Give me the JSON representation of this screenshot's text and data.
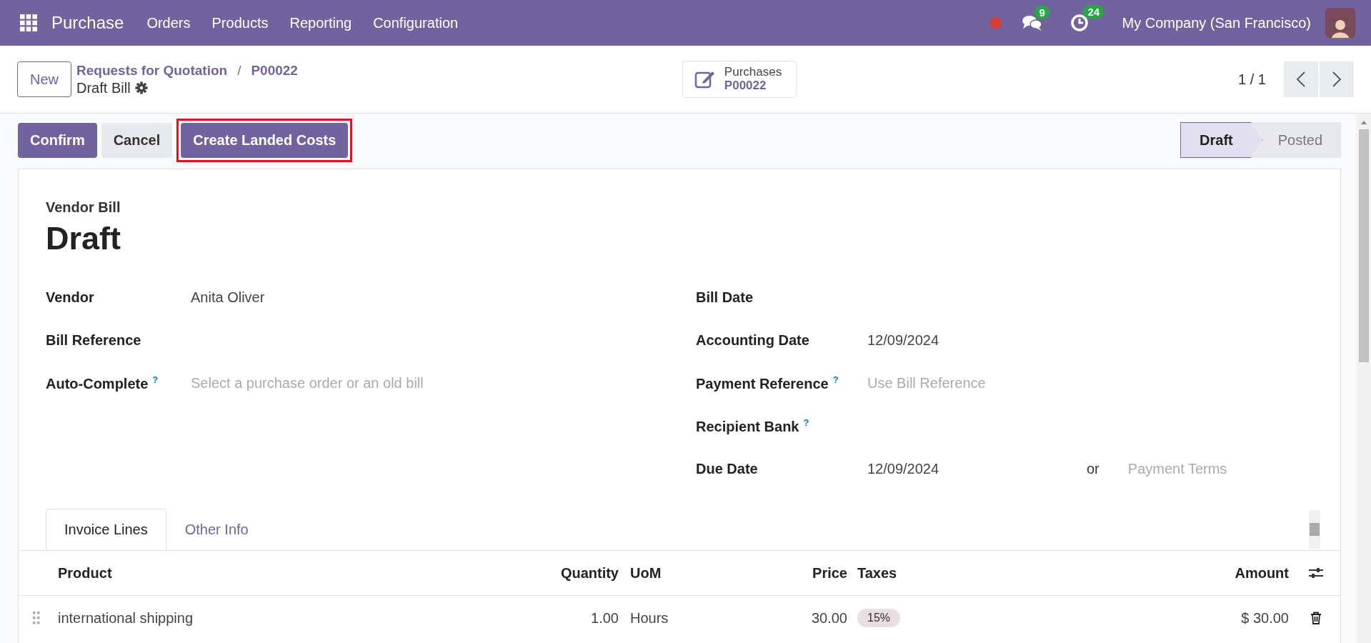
{
  "navbar": {
    "app_name": "Purchase",
    "menu": [
      "Orders",
      "Products",
      "Reporting",
      "Configuration"
    ],
    "status_dot": {
      "color": "#d23f3a"
    },
    "messages": {
      "count": "9"
    },
    "activities": {
      "count": "24"
    },
    "company": "My Company (San Francisco)"
  },
  "control_panel": {
    "new_button": "New",
    "breadcrumbs": [
      "Requests for Quotation",
      "P00022"
    ],
    "breadcrumb_separator": "/",
    "title": "Draft Bill",
    "smart_button": {
      "label": "Purchases",
      "value": "P00022"
    },
    "pager": "1 / 1"
  },
  "actions": [
    {
      "label": "Confirm",
      "kind": "primary",
      "highlighted": false
    },
    {
      "label": "Cancel",
      "kind": "secondary",
      "highlighted": false
    },
    {
      "label": "Create Landed Costs",
      "kind": "primary",
      "highlighted": true
    }
  ],
  "statusbar": [
    {
      "label": "Draft",
      "selected": true
    },
    {
      "label": "Posted",
      "selected": false
    }
  ],
  "form": {
    "subtitle": "Vendor Bill",
    "title": "Draft",
    "left_fields": [
      {
        "label": "Vendor",
        "value": "Anita Oliver"
      },
      {
        "label": "Bill Reference"
      },
      {
        "label": "Auto-Complete",
        "help": "?",
        "placeholder": "Select a purchase order or an old bill"
      }
    ],
    "right_fields": [
      {
        "label": "Bill Date"
      },
      {
        "label": "Accounting Date",
        "value": "12/09/2024"
      },
      {
        "label": "Payment Reference",
        "help": "?",
        "placeholder": "Use Bill Reference"
      },
      {
        "label": "Recipient Bank",
        "help": "?"
      },
      {
        "label": "Due Date",
        "value": "12/09/2024",
        "separator": "or",
        "extra_placeholder": "Payment Terms"
      }
    ]
  },
  "tabs": [
    {
      "label": "Invoice Lines",
      "selected": true
    },
    {
      "label": "Other Info",
      "selected": false
    }
  ],
  "table": {
    "columns": [
      "Product",
      "Quantity",
      "UoM",
      "Price",
      "Taxes",
      "Amount"
    ],
    "rows": [
      {
        "product": "international shipping",
        "quantity": "1.00",
        "uom": "Hours",
        "price": "30.00",
        "taxes": "15%",
        "amount": "$ 30.00"
      }
    ]
  }
}
